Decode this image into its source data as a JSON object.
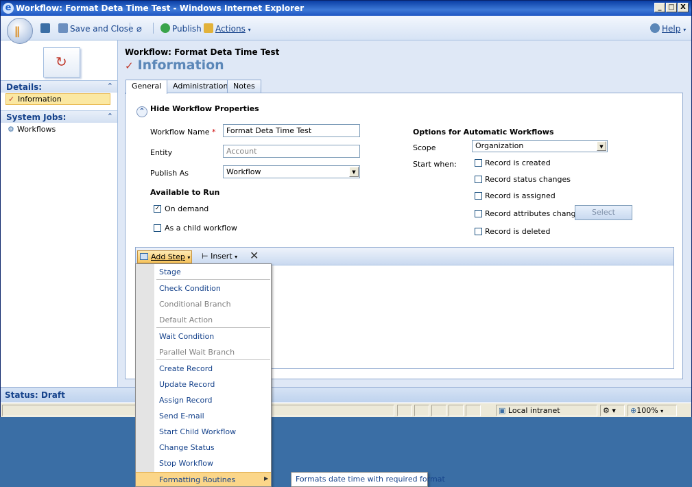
{
  "window": {
    "title": "Workflow: Format Deta Time Test - Windows Internet Explorer",
    "minimize": "_",
    "maximize": "□",
    "close": "X"
  },
  "toolbar": {
    "save_label": "Save and Close",
    "publish_label": "Publish",
    "actions_label": "Actions",
    "help_label": "Help"
  },
  "left_nav": {
    "details_header": "Details:",
    "information_item": "Information",
    "system_jobs_header": "System Jobs:",
    "workflows_item": "Workflows"
  },
  "header": {
    "breadcrumb": "Workflow: Format Deta Time Test",
    "title": "Information"
  },
  "tabs": [
    "General",
    "Administration",
    "Notes"
  ],
  "form": {
    "hide_properties": "Hide Workflow Properties",
    "workflow_name_label": "Workflow Name",
    "required_mark": "*",
    "workflow_name_value": "Format Deta Time Test",
    "entity_label": "Entity",
    "entity_value": "Account",
    "publish_as_label": "Publish As",
    "publish_as_value": "Workflow",
    "available_header": "Available to Run",
    "on_demand": "On demand",
    "child_workflow": "As a child workflow",
    "options_header": "Options for Automatic Workflows",
    "scope_label": "Scope",
    "scope_value": "Organization",
    "start_when_label": "Start when:",
    "triggers": [
      "Record is created",
      "Record status changes",
      "Record is assigned",
      "Record attributes change",
      "Record is deleted"
    ],
    "select_button": "Select"
  },
  "steps_toolbar": {
    "add_step": "Add Step",
    "insert": "Insert"
  },
  "add_step_menu": {
    "items": [
      {
        "label": "Stage",
        "enabled": true
      },
      {
        "label": "Check Condition",
        "enabled": true
      },
      {
        "label": "Conditional Branch",
        "enabled": false
      },
      {
        "label": "Default Action",
        "enabled": false
      },
      {
        "label": "Wait Condition",
        "enabled": true
      },
      {
        "label": "Parallel Wait Branch",
        "enabled": false
      },
      {
        "label": "Create Record",
        "enabled": true
      },
      {
        "label": "Update Record",
        "enabled": true
      },
      {
        "label": "Assign Record",
        "enabled": true
      },
      {
        "label": "Send E-mail",
        "enabled": true
      },
      {
        "label": "Start Child Workflow",
        "enabled": true
      },
      {
        "label": "Change Status",
        "enabled": true
      },
      {
        "label": "Stop Workflow",
        "enabled": true
      },
      {
        "label": "Formatting Routines",
        "enabled": true
      }
    ],
    "submenu_item": "Formats date time with required format"
  },
  "status": {
    "text": "Status: Draft"
  },
  "ie_status": {
    "zone": "Local intranet",
    "zoom": "100%"
  },
  "colors": {
    "accent": "#15428b",
    "highlight": "#fbd689",
    "title_blue": "#5b87b8"
  }
}
